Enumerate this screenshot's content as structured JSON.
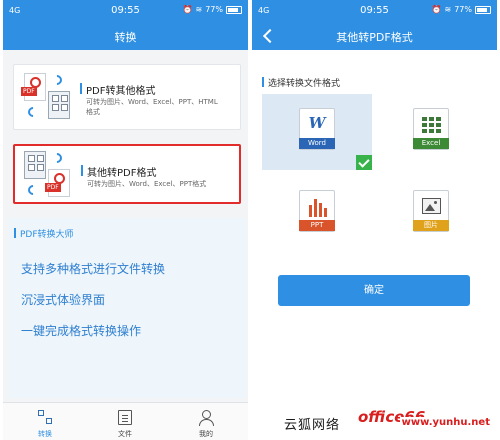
{
  "status_bar": {
    "left": "4G",
    "time": "09:55",
    "battery_text": "77%"
  },
  "left_screen": {
    "nav_title": "转换",
    "cards": [
      {
        "title": "PDF转其他格式",
        "desc": "可转为图片、Word、Excel、PPT、HTML",
        "desc_line2": "格式",
        "pdf_tag": "PDF"
      },
      {
        "title": "其他转PDF格式",
        "desc": "可转为图片、Word、Excel、PPT格式",
        "pdf_tag": "PDF"
      }
    ],
    "section": {
      "title": "PDF转换大师",
      "features": [
        "支持多种格式进行文件转换",
        "沉浸式体验界面",
        "一键完成格式转换操作"
      ]
    },
    "tabs": [
      {
        "label": "转换",
        "icon": "convert-icon",
        "active": true
      },
      {
        "label": "文件",
        "icon": "file-icon",
        "active": false
      },
      {
        "label": "我的",
        "icon": "user-icon",
        "active": false
      }
    ]
  },
  "right_screen": {
    "nav_title": "其他转PDF格式",
    "choose_label": "选择转换文件格式",
    "formats": [
      {
        "label": "Word",
        "color": "#2b66b6",
        "selected": true,
        "icon": "word-icon"
      },
      {
        "label": "Excel",
        "color": "#3d8a36",
        "selected": false,
        "icon": "excel-icon"
      },
      {
        "label": "PPT",
        "color": "#d9532b",
        "selected": false,
        "icon": "ppt-icon"
      },
      {
        "label": "图片",
        "color": "#e0a21a",
        "selected": false,
        "icon": "image-icon"
      }
    ],
    "confirm_label": "确定"
  },
  "watermark": {
    "cn": "云狐网络",
    "logo": "office66",
    "url": "www.yunhu.net"
  },
  "colors": {
    "accent": "#2f8fe2",
    "highlight_border": "#e22b2b",
    "check": "#38b24a"
  }
}
